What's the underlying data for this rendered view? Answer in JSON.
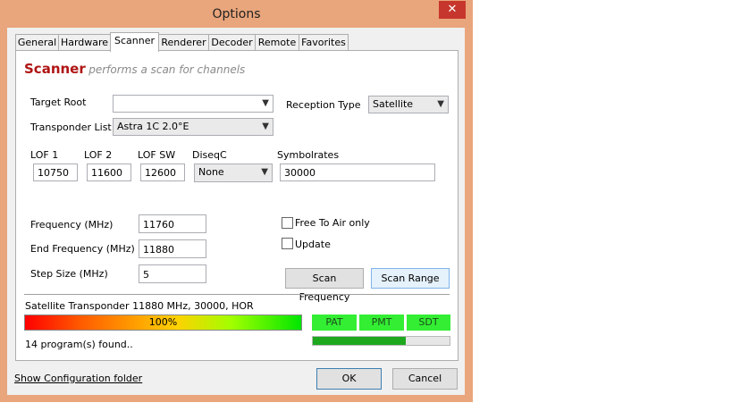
{
  "window": {
    "title": "Options",
    "close_glyph": "✕"
  },
  "tabs": [
    {
      "label": "General"
    },
    {
      "label": "Hardware"
    },
    {
      "label": "Scanner"
    },
    {
      "label": "Renderer"
    },
    {
      "label": "Decoder"
    },
    {
      "label": "Remote"
    },
    {
      "label": "Favorites"
    }
  ],
  "header": {
    "title": "Scanner",
    "subtitle": "performs a scan for channels"
  },
  "form": {
    "target_root": {
      "label": "Target Root",
      "value": ""
    },
    "reception_type": {
      "label": "Reception Type",
      "value": "Satellite"
    },
    "transponder_list": {
      "label": "Transponder List",
      "value": "Astra 1C 2.0°E"
    },
    "lof1": {
      "label": "LOF 1",
      "value": "10750"
    },
    "lof2": {
      "label": "LOF 2",
      "value": "11600"
    },
    "lofsw": {
      "label": "LOF SW",
      "value": "12600"
    },
    "diseqc": {
      "label": "DiseqC",
      "value": "None"
    },
    "symbolrates": {
      "label": "Symbolrates",
      "value": "30000"
    },
    "frequency": {
      "label": "Frequency (MHz)",
      "value": "11760"
    },
    "end_frequency": {
      "label": "End  Frequency (MHz)",
      "value": "11880"
    },
    "step_size": {
      "label": "Step Size (MHz)",
      "value": "5"
    },
    "free_to_air": {
      "label": "Free To Air only",
      "checked": false
    },
    "update": {
      "label": "Update",
      "checked": false
    },
    "scan_frequency_label": "Scan Frequency",
    "scan_range_label": "Scan Range"
  },
  "status": {
    "text": "Satellite Transponder 11880 MHz, 30000, HOR",
    "progress_label": "100%",
    "progress": 1.0,
    "found": "14 program(s) found..",
    "indicators": [
      "PAT",
      "PMT",
      "SDT"
    ],
    "indicator_color": "#33ee33",
    "secondary_progress": 0.68
  },
  "footer": {
    "config_link": "Show Configuration folder",
    "ok_label": "OK",
    "cancel_label": "Cancel"
  },
  "colors": {
    "accent": "#b01515",
    "window_frame": "#e9a57b",
    "close_button": "#c7362c",
    "progress_green": "#1ea81e"
  }
}
